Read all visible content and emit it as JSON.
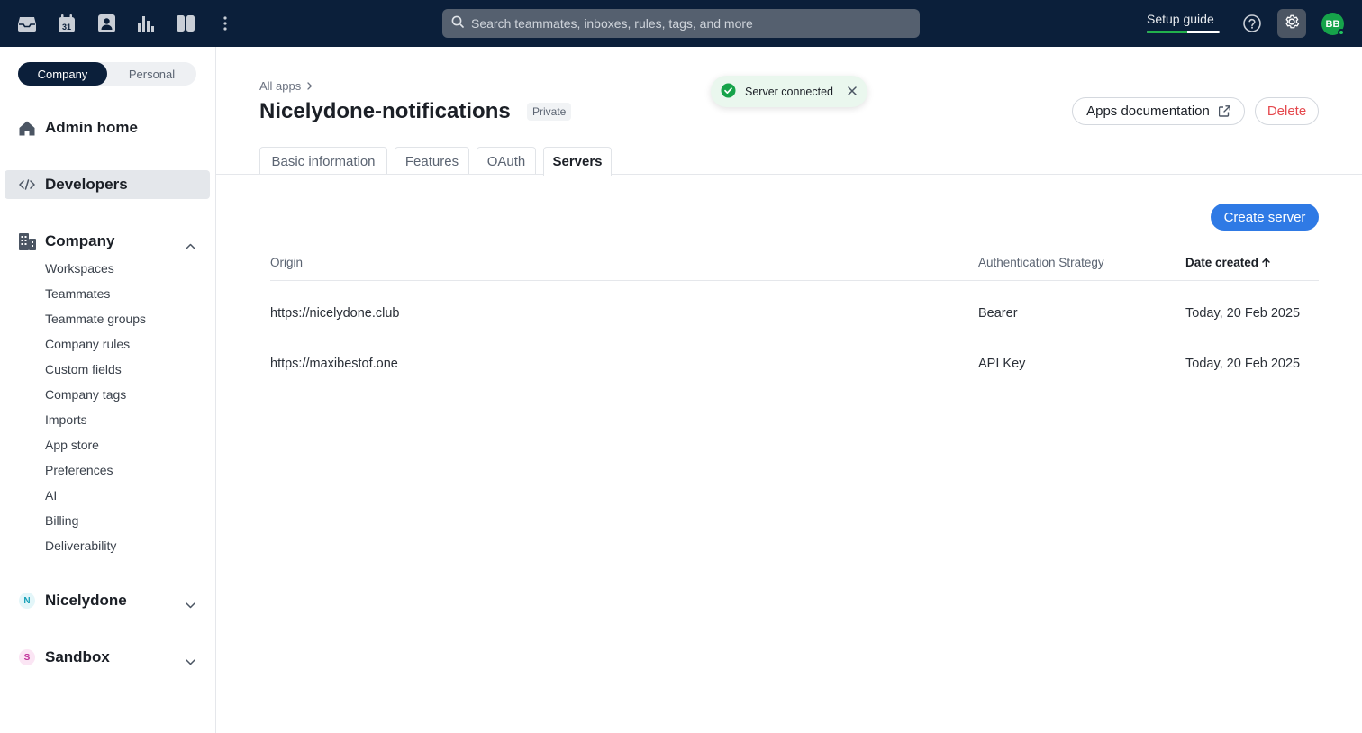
{
  "topbar": {
    "search_placeholder": "Search teammates, inboxes, rules, tags, and more",
    "setup_guide_label": "Setup guide",
    "setup_progress": 0.55,
    "calendar_day": "31",
    "avatar_initials": "BB",
    "icons": [
      "inbox-icon",
      "calendar-icon",
      "contacts-icon",
      "analytics-icon",
      "split-view-icon",
      "more-vertical-icon",
      "search-icon",
      "help-icon",
      "gear-icon"
    ]
  },
  "sidebar": {
    "switch": {
      "company": "Company",
      "personal": "Personal"
    },
    "admin_home": "Admin home",
    "developers": "Developers",
    "company_section": {
      "title": "Company",
      "items": [
        "Workspaces",
        "Teammates",
        "Teammate groups",
        "Company rules",
        "Custom fields",
        "Company tags",
        "Imports",
        "App store",
        "Preferences",
        "AI",
        "Billing",
        "Deliverability"
      ]
    },
    "workspaces": [
      {
        "initial": "N",
        "name": "Nicelydone",
        "color": "#16a0b8",
        "bg": "#e3f6f9"
      },
      {
        "initial": "S",
        "name": "Sandbox",
        "color": "#c0309a",
        "bg": "#fbe5f4"
      }
    ]
  },
  "main": {
    "breadcrumb": "All apps",
    "title": "Nicelydone-notifications",
    "badge": "Private",
    "toast": "Server connected",
    "apps_doc_label": "Apps documentation",
    "delete_label": "Delete",
    "tabs": [
      "Basic information",
      "Features",
      "OAuth",
      "Servers"
    ],
    "active_tab": "Servers",
    "create_server_label": "Create server",
    "table": {
      "headers": {
        "origin": "Origin",
        "auth": "Authentication Strategy",
        "date": "Date created"
      },
      "rows": [
        {
          "origin": "https://nicelydone.club",
          "auth": "Bearer",
          "date": "Today, 20 Feb 2025"
        },
        {
          "origin": "https://maxibestof.one",
          "auth": "API Key",
          "date": "Today, 20 Feb 2025"
        }
      ]
    }
  },
  "colors": {
    "topbar_bg": "#0b1f3a",
    "accent_blue": "#2f7ae5",
    "delete_red": "#e5484d",
    "success_green": "#16a34a"
  }
}
